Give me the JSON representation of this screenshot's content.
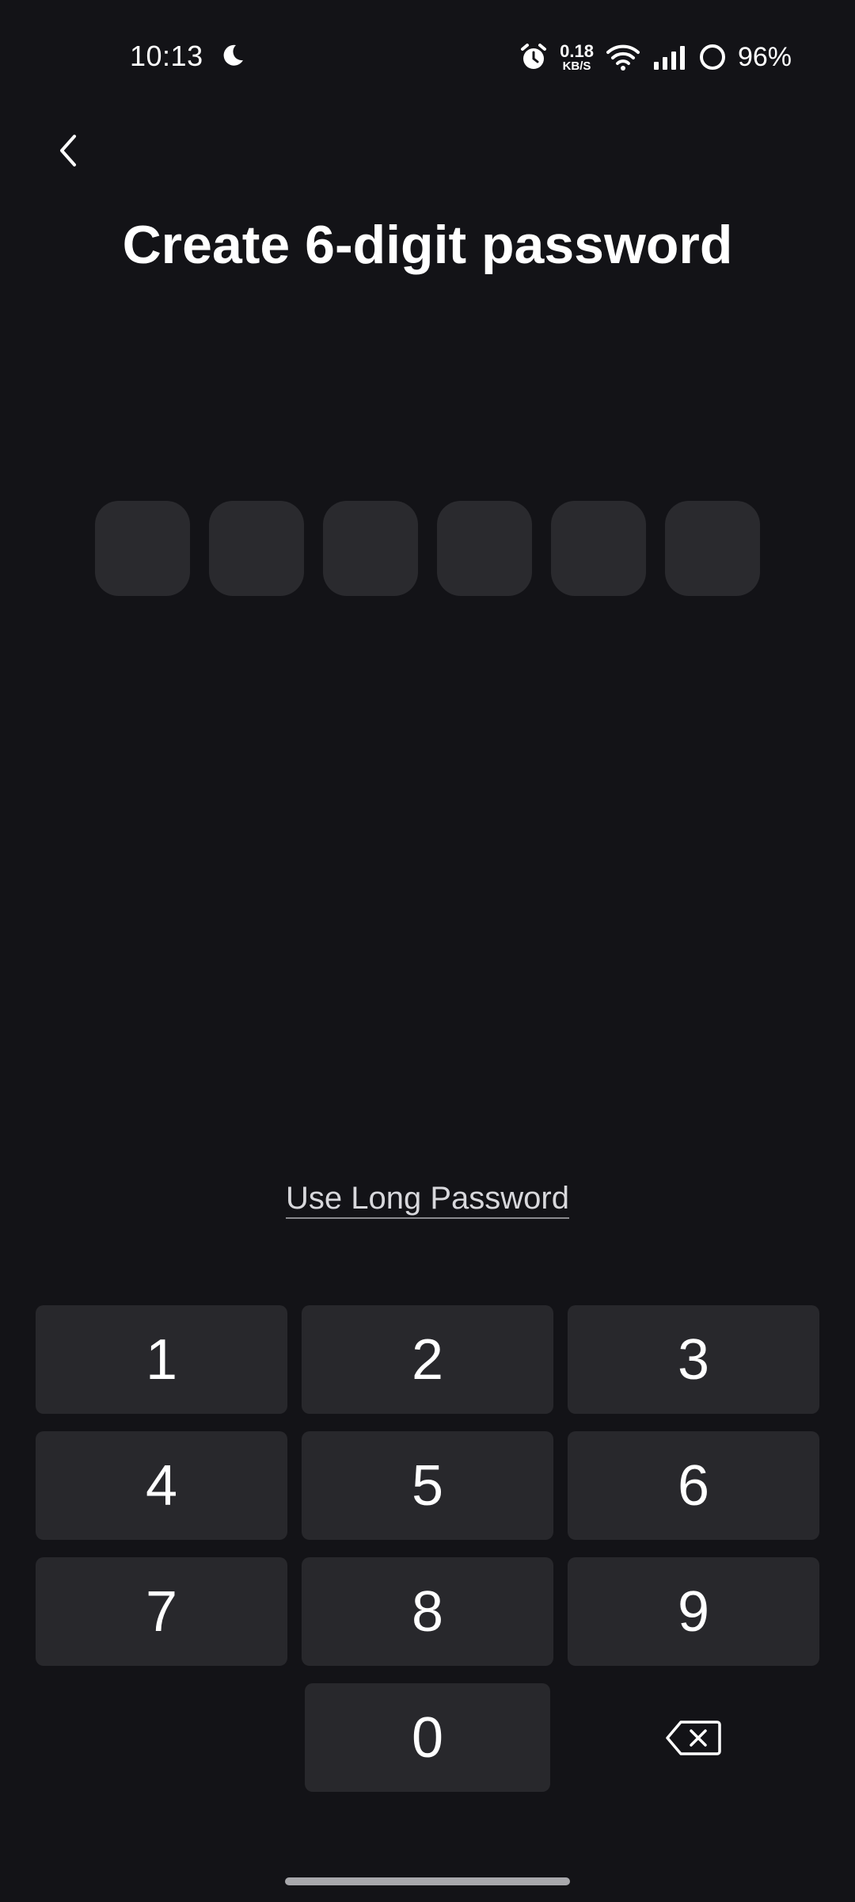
{
  "status_bar": {
    "time": "10:13",
    "net_speed_value": "0.18",
    "net_speed_unit": "KB/S",
    "battery": "96%",
    "icons": [
      "moon-icon",
      "alarm-icon",
      "wifi-icon",
      "signal-icon",
      "battery-icon"
    ]
  },
  "header": {
    "back_icon": "chevron-left-icon",
    "title": "Create 6-digit password"
  },
  "pin": {
    "length": 6,
    "filled": 0
  },
  "long_password_link": "Use Long Password",
  "keypad": {
    "keys": [
      "1",
      "2",
      "3",
      "4",
      "5",
      "6",
      "7",
      "8",
      "9",
      "0"
    ],
    "backspace_icon": "backspace-icon"
  },
  "colors": {
    "background": "#131317",
    "pin_box": "#2a2a2e",
    "key": "#28282c",
    "text": "#ffffff"
  }
}
